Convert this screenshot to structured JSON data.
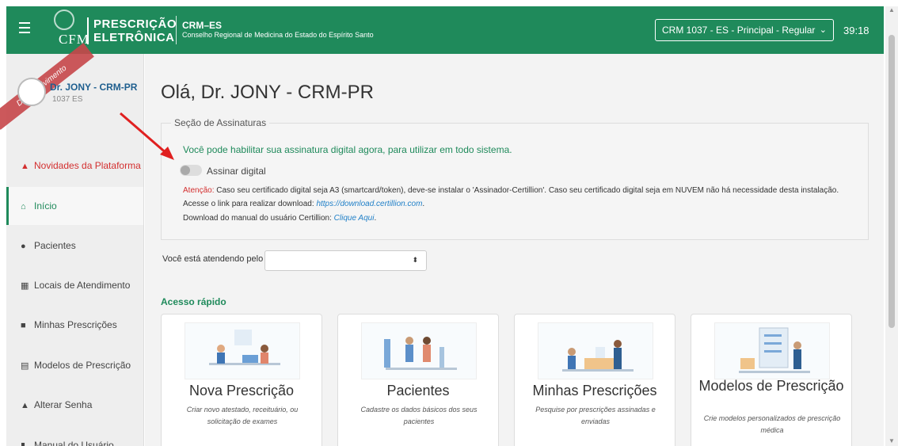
{
  "header": {
    "logo_text": "CFM",
    "title_line1": "PRESCRIÇÃO",
    "title_line2": "ELETRÔNICA",
    "crm_title": "CRM–ES",
    "crm_subtitle": "Conselho Regional de Medicina do Estado do Espírito Santo",
    "crm_select_value": "CRM 1037 - ES - Principal - Regular",
    "timer": "39:18",
    "ribbon": "Desenvolvimento",
    "colors": {
      "primary": "#1f8a5b",
      "alert": "#d32f2f",
      "link": "#1f7fc7"
    }
  },
  "sidebar": {
    "user_name": "Dr. JONY - CRM-PR",
    "user_code": "1037 ES",
    "items": [
      {
        "label": "Novidades da Plataforma",
        "icon": "bell-icon"
      },
      {
        "label": "Início",
        "icon": "home-icon"
      },
      {
        "label": "Pacientes",
        "icon": "user-icon"
      },
      {
        "label": "Locais de Atendimento",
        "icon": "building-icon"
      },
      {
        "label": "Minhas Prescrições",
        "icon": "clipboard-icon"
      },
      {
        "label": "Modelos de Prescrição",
        "icon": "file-icon"
      },
      {
        "label": "Alterar Senha",
        "icon": "lock-icon"
      },
      {
        "label": "Manual do Usuário",
        "icon": "book-icon"
      }
    ]
  },
  "main": {
    "greeting": "Olá, Dr. JONY - CRM-PR",
    "signature": {
      "legend": "Seção de Assinaturas",
      "message": "Você pode habilitar sua assinatura digital agora, para utilizar em todo sistema.",
      "toggle_label": "Assinar digital",
      "warning_prefix": "Atenção:",
      "warning_text": " Caso seu certificado digital seja A3 (smartcard/token), deve-se instalar o 'Assinador-Certillion'. Caso seu certificado digital seja em NUVEM não há necessidade desta instalação.",
      "download_text": "Acesse o link para realizar download: ",
      "download_link": "https://download.certillion.com",
      "download_suffix": ".",
      "manual_text": "Download do manual do usuário Certillion: ",
      "manual_link": "Clique Aqui",
      "manual_suffix": "."
    },
    "atendimento_label": "Você está atendendo pelo",
    "quick_access_title": "Acesso rápido",
    "cards": [
      {
        "title": "Nova Prescrição",
        "desc": "Criar novo atestado, receituário, ou solicitação de exames"
      },
      {
        "title": "Pacientes",
        "desc": "Cadastre os dados básicos dos seus pacientes"
      },
      {
        "title": "Minhas Prescrições",
        "desc": "Pesquise por prescrições assinadas e enviadas"
      },
      {
        "title": "Modelos de Prescrição",
        "desc": "Crie modelos personalizados de prescrição médica"
      }
    ]
  }
}
